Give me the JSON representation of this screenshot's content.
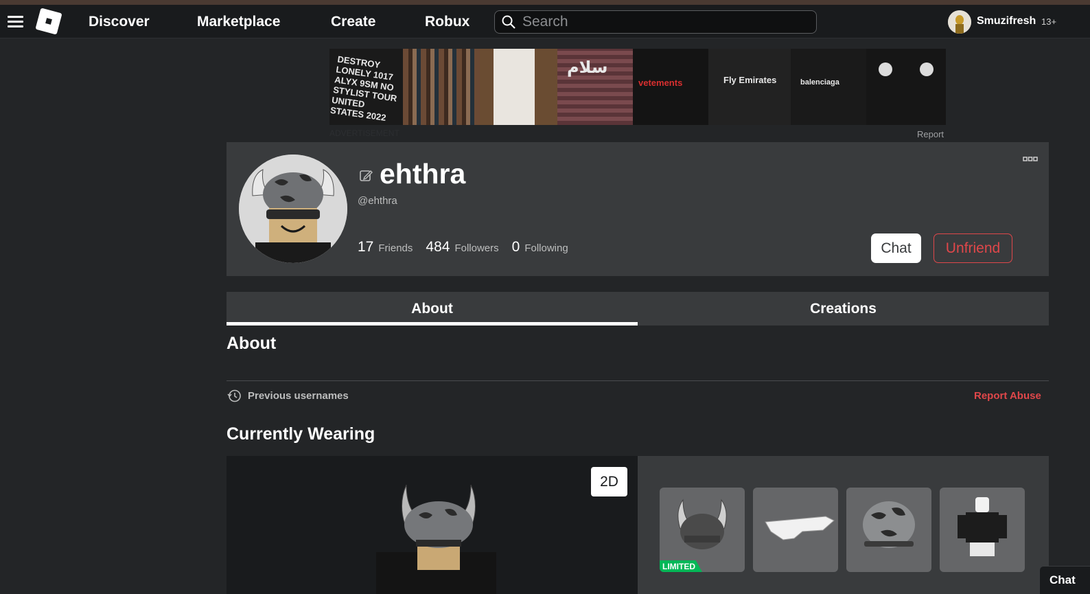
{
  "nav": {
    "links": [
      "Discover",
      "Marketplace",
      "Create",
      "Robux"
    ],
    "search_placeholder": "Search",
    "username": "Smuzifresh",
    "age_badge": "13+"
  },
  "ad": {
    "label": "ADVERTISEMENT",
    "report": "Report",
    "tile_texts": [
      "DESTROY LONELY 1017 ALYX 9SM NO STYLIST TOUR UNITED STATES 2022",
      "",
      "",
      "سلام",
      "vetements",
      "Fly Emirates",
      "balenciaga",
      ""
    ]
  },
  "profile": {
    "display_name": "ehthra",
    "handle": "@ehthra",
    "friends_count": "17",
    "friends_label": "Friends",
    "followers_count": "484",
    "followers_label": "Followers",
    "following_count": "0",
    "following_label": "Following",
    "chat_button": "Chat",
    "unfriend_button": "Unfriend"
  },
  "tabs": [
    {
      "label": "About",
      "active": true
    },
    {
      "label": "Creations",
      "active": false
    }
  ],
  "about": {
    "title": "About",
    "previous_usernames": "Previous usernames",
    "report_abuse": "Report Abuse"
  },
  "wearing": {
    "title": "Currently Wearing",
    "toggle_2d": "2D",
    "items": [
      {
        "name": "viking-helmet",
        "badge": "LIMITED"
      },
      {
        "name": "white-sunglasses",
        "badge": ""
      },
      {
        "name": "camo-helmet",
        "badge": ""
      },
      {
        "name": "avatar-outfit",
        "badge": ""
      }
    ]
  },
  "chat_widget": "Chat"
}
